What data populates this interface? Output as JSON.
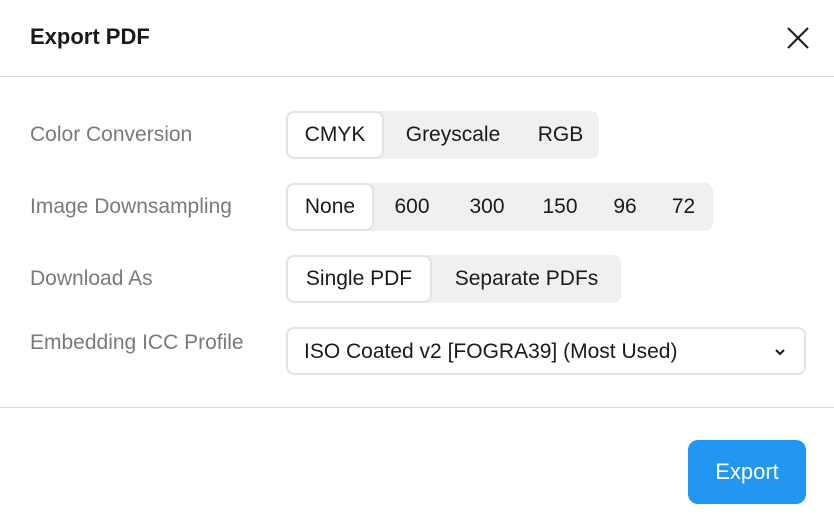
{
  "dialog": {
    "title": "Export PDF",
    "close_icon": "close-icon"
  },
  "color_conversion": {
    "label": "Color Conversion",
    "options": [
      "CMYK",
      "Greyscale",
      "RGB"
    ],
    "selected": "CMYK"
  },
  "image_downsampling": {
    "label": "Image Downsampling",
    "options": [
      "None",
      "600",
      "300",
      "150",
      "96",
      "72"
    ],
    "selected": "None"
  },
  "download_as": {
    "label": "Download As",
    "options": [
      "Single PDF",
      "Separate PDFs"
    ],
    "selected": "Single PDF"
  },
  "icc_profile": {
    "label": "Embedding ICC Profile",
    "value": "ISO Coated v2 [FOGRA39] (Most Used)",
    "icon": "chevron-down-icon"
  },
  "footer": {
    "export_label": "Export"
  },
  "colors": {
    "accent": "#2196f3"
  }
}
